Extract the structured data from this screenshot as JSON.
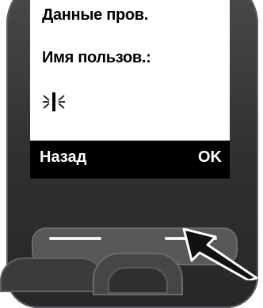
{
  "screen": {
    "line1": "Данные пров.",
    "line2": "Имя пользов.:",
    "cursor_icon": "text-cursor-blinking-icon"
  },
  "softkeys": {
    "left_label": "Назад",
    "right_label": "OK"
  },
  "indicator": {
    "icon": "pointer-arrow-icon"
  },
  "colors": {
    "screen_bg": "#ffffff",
    "softkey_bar_bg": "#000000",
    "text": "#000000",
    "phone_body": "#2f3032"
  }
}
